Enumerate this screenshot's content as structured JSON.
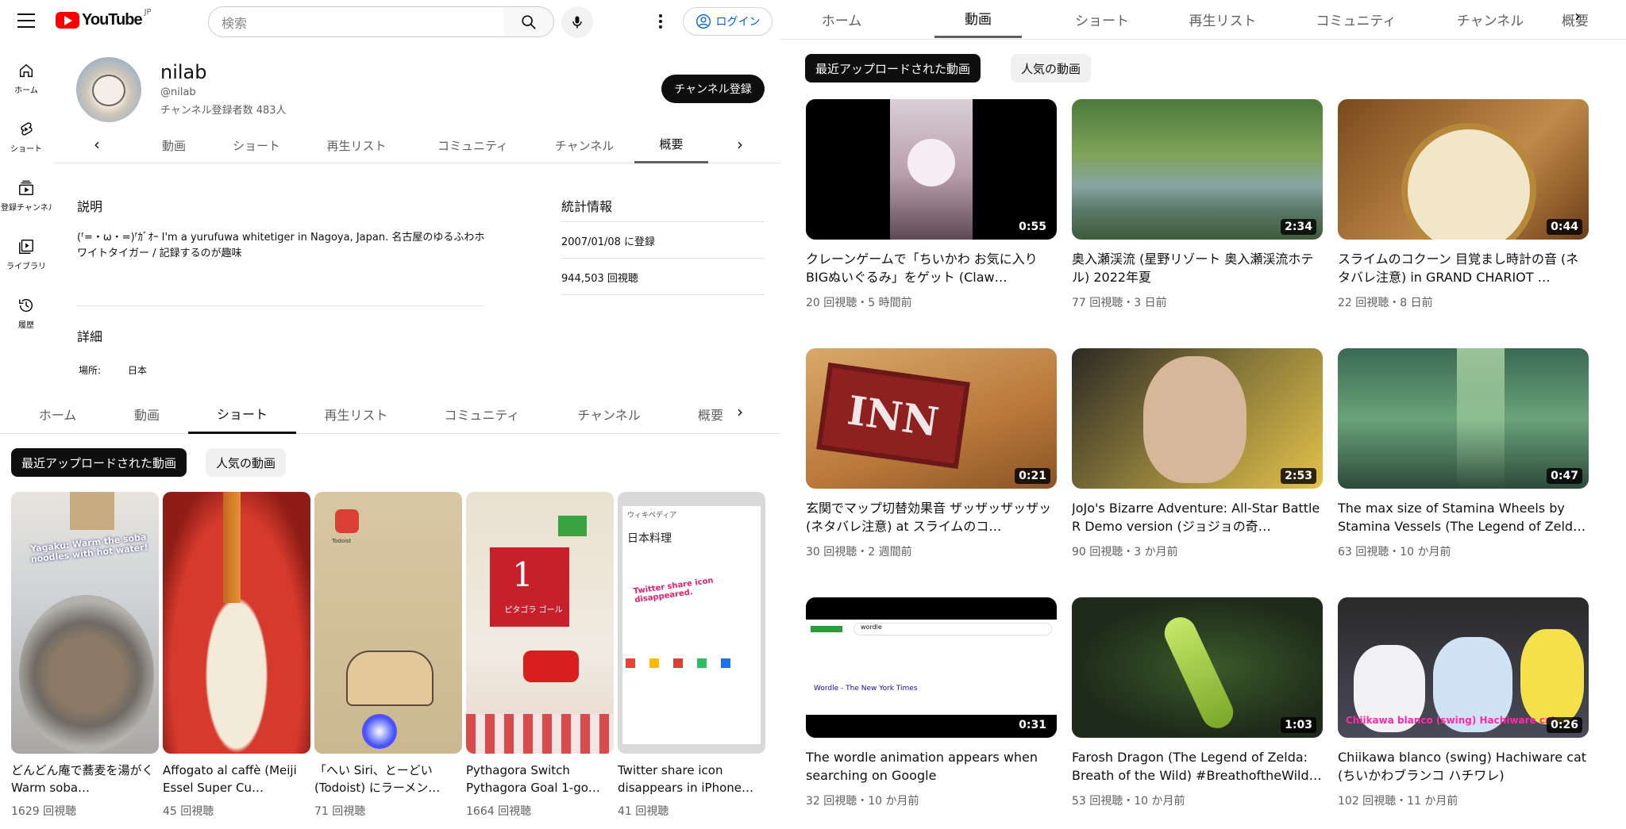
{
  "header": {
    "logo_text": "YouTube",
    "logo_country": "JP",
    "search_placeholder": "検索",
    "login_label": "ログイン"
  },
  "sidebar": {
    "items": [
      {
        "label": "ホーム",
        "icon": "home-icon"
      },
      {
        "label": "ショート",
        "icon": "shorts-icon"
      },
      {
        "label": "登録チャンネル",
        "icon": "subscriptions-icon"
      },
      {
        "label": "ライブラリ",
        "icon": "library-icon"
      },
      {
        "label": "履歴",
        "icon": "history-icon"
      }
    ]
  },
  "channel": {
    "name": "nilab",
    "handle": "@nilab",
    "subscribers": "チャンネル登録者数 483人",
    "subscribe_label": "チャンネル登録"
  },
  "tabs_top": [
    "動画",
    "ショート",
    "再生リスト",
    "コミュニティ",
    "チャンネル",
    "概要"
  ],
  "about": {
    "description_heading": "説明",
    "description": "(ᶠ=・ω・=)ᶠｶﾞｵｰ I'm a yurufuwa whitetiger in Nagoya, Japan. 名古屋のゆるふわホワイトタイガー / 記録するのが趣味",
    "details_heading": "詳細",
    "location_label": "場所:",
    "location_value": "日本",
    "stats_heading": "統計情報",
    "joined": "2007/01/08 に登録",
    "views": "944,503 回視聴"
  },
  "tabs_mid": [
    "ホーム",
    "動画",
    "ショート",
    "再生リスト",
    "コミュニティ",
    "チャンネル",
    "概要"
  ],
  "chips": {
    "recent": "最近アップロードされた動画",
    "popular": "人気の動画"
  },
  "shorts": [
    {
      "title": "どんどん庵で蕎麦を湯がく Warm soba…",
      "views": "1629 回視聴",
      "overlay": "Yagaku: Warm the soba noodles with hot water!"
    },
    {
      "title": "Affogato al caffè (Meiji Essel Super Cu…",
      "views": "45 回視聴"
    },
    {
      "title": "「へい Siri、とーどい (Todoist) にラーメン…",
      "views": "71 回視聴",
      "app": "Todoist"
    },
    {
      "title": "Pythagora Switch Pythagora Goal 1-go…",
      "views": "1664 回視聴",
      "sign": "1",
      "sign_text": "ピタゴラ ゴール"
    },
    {
      "title": "Twitter share icon disappears in iPhone…",
      "views": "41 回視聴",
      "overlay": "Twitter share icon disappeared.",
      "wiki_title": "ウィキペディア",
      "wiki_heading": "日本料理"
    }
  ],
  "right_tabs": [
    "ホーム",
    "動画",
    "ショート",
    "再生リスト",
    "コミュニティ",
    "チャンネル",
    "概要"
  ],
  "videos": [
    {
      "title": "クレーンゲームで「ちいかわ お気に入りBIGぬいぐるみ」をゲット (Claw…",
      "meta": "20 回視聴・5 時間前",
      "duration": "0:55"
    },
    {
      "title": "奥入瀬渓流 (星野リゾート 奥入瀬渓流ホテル) 2022年夏",
      "meta": "77 回視聴・3 日前",
      "duration": "2:34"
    },
    {
      "title": "スライムのコクーン 目覚まし時計の音 (ネタバレ注意) in GRAND CHARIOT …",
      "meta": "22 回視聴・8 日前",
      "duration": "0:44"
    },
    {
      "title": "玄関でマップ切替効果音 ザッザッザッザッ (ネタバレ注意) at スライムのコ…",
      "meta": "30 回視聴・2 週間前",
      "duration": "0:21",
      "sign": "INN"
    },
    {
      "title": "JoJo's Bizarre Adventure: All-Star Battle R Demo version (ジョジョの奇…",
      "meta": "90 回視聴・3 か月前",
      "duration": "2:53"
    },
    {
      "title": "The max size of Stamina Wheels by Stamina Vessels (The Legend of Zeld…",
      "meta": "63 回視聴・10 か月前",
      "duration": "0:47"
    },
    {
      "title": "The wordle animation appears when searching on Google",
      "meta": "32 回視聴・10 か月前",
      "duration": "0:31",
      "search_text": "wordle",
      "result_title": "Wordle - The New York Times"
    },
    {
      "title": "Farosh Dragon (The Legend of Zelda: Breath of the Wild) #BreathoftheWild…",
      "meta": "53 回視聴・10 か月前",
      "duration": "1:03"
    },
    {
      "title": "Chiikawa blanco (swing) Hachiware cat (ちいかわブランコ ハチワレ)",
      "meta": "102 回視聴・11 か月前",
      "duration": "0:26",
      "overlay": "Chiikawa blanco (swing) Hachiware cat"
    }
  ]
}
